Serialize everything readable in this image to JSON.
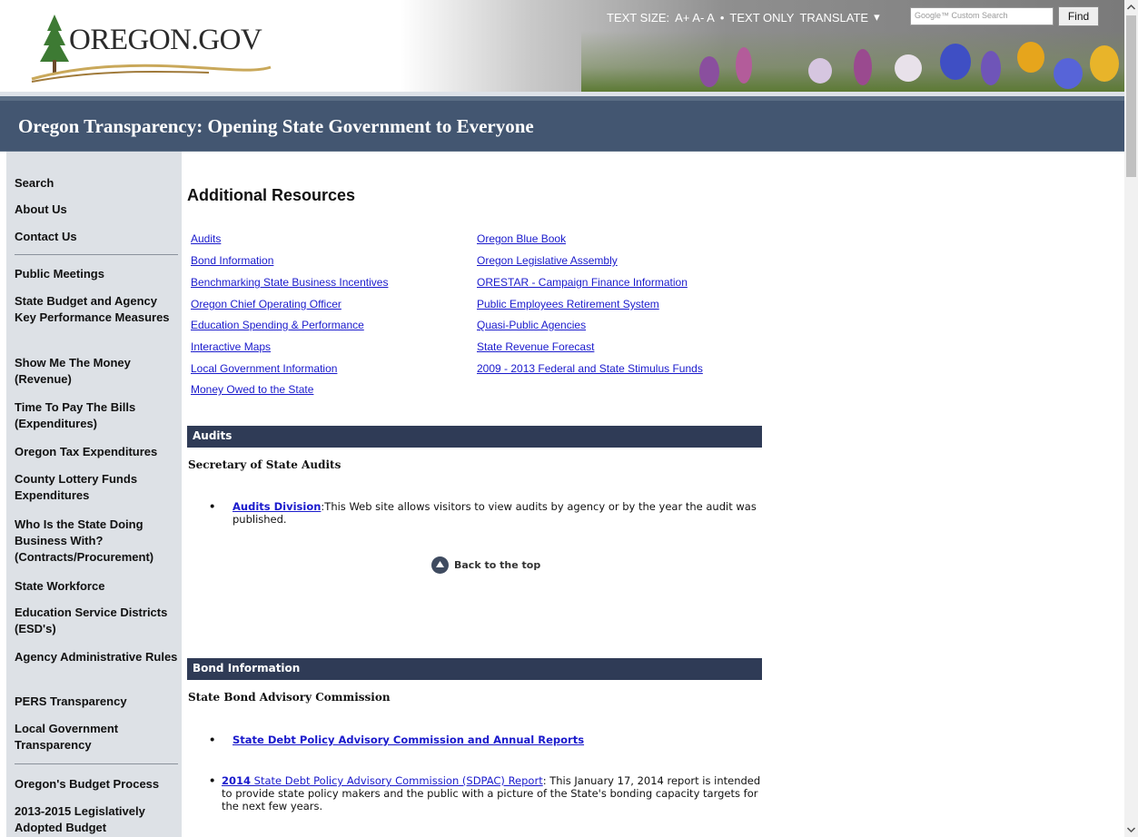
{
  "header": {
    "logo_text": "OREGON.GOV",
    "tools": {
      "text_size_label": "TEXT SIZE:",
      "text_size_options": "A+ A- A",
      "separator": "•",
      "text_only": "TEXT ONLY",
      "translate": "TRANSLATE",
      "translate_arrow": "▾"
    },
    "search": {
      "placeholder": "Google™ Custom Search"
    },
    "find_button": "Find"
  },
  "banner": {
    "title": "Oregon Transparency: Opening State Government to Everyone"
  },
  "sidebar": {
    "items": [
      "Search",
      "About Us",
      "Contact Us",
      "Public Meetings",
      "State Budget and Agency Key Performance Measures",
      "Show Me The Money (Revenue)",
      "Time To Pay The Bills (Expenditures)",
      "Oregon Tax Expenditures",
      "County Lottery Funds Expenditures",
      "Who Is the State Doing Business With? (Contracts/Procurement)",
      "State Workforce",
      "Education Service Districts (ESD's)",
      "Agency Administrative Rules",
      "PERS Transparency",
      "Local Government Transparency",
      "Oregon's Budget Process",
      "2013-2015 Legislatively Adopted Budget"
    ]
  },
  "main": {
    "title": "Additional Resources",
    "links_left": [
      "Audits",
      "Bond Information",
      "Benchmarking State Business Incentives",
      "Oregon Chief Operating Officer",
      "Education Spending & Performance",
      "Interactive Maps",
      "Local Government Information",
      "Money Owed to the State"
    ],
    "links_right": [
      "Oregon Blue Book",
      "Oregon Legislative Assembly",
      "ORESTAR - Campaign Finance Information",
      "Public Employees Retirement System",
      "Quasi-Public Agencies",
      "State Revenue Forecast",
      "2009 - 2013 Federal and State Stimulus Funds"
    ],
    "audits": {
      "heading": "Audits",
      "subheading": "Secretary of State Audits",
      "link": "Audits Division",
      "text": ":This Web site allows visitors to view audits by agency or by the year the audit was published."
    },
    "back_to_top": "Back to the top",
    "bonds": {
      "heading": "Bond Information",
      "subheading": "State Bond Advisory Commission",
      "link1": "State Debt Policy Advisory Commission and Annual Reports",
      "link2_year": "2014",
      "link2": " State Debt Policy Advisory Commission (SDPAC) Report",
      "text2": ": This January 17, 2014 report is intended to provide state policy makers and the public with a picture of the State's bonding capacity targets for the next few years."
    }
  },
  "colors": {
    "banner": "#435671",
    "section_bar": "#2f3b56",
    "sidebar": "#dde1e6",
    "link": "#1a1acc"
  }
}
